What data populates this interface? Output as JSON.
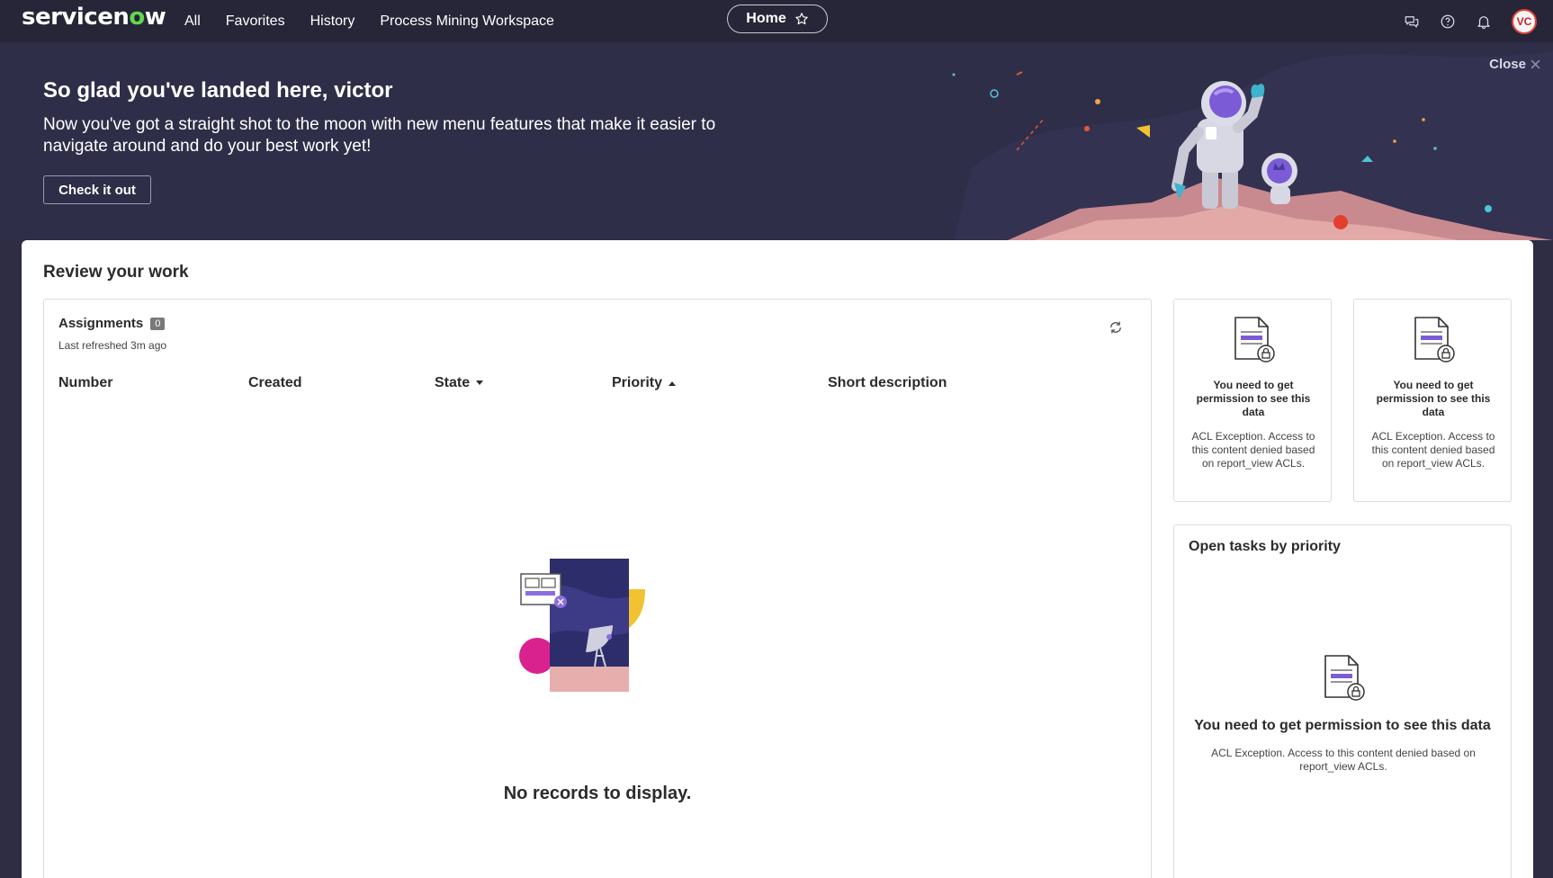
{
  "nav": {
    "logo_a": "servicen",
    "logo_o": "o",
    "logo_b": "w",
    "links": [
      "All",
      "Favorites",
      "History",
      "Process Mining Workspace"
    ],
    "home_label": "Home",
    "avatar_initials": "VC",
    "icons": [
      "chat-icon",
      "help-icon",
      "bell-icon"
    ]
  },
  "banner": {
    "title": "So glad you've landed here, victor",
    "subtitle": "Now you've got a straight shot to the moon with new menu features that make it easier to navigate around and do your best work yet!",
    "button": "Check it out",
    "close": "Close"
  },
  "review": {
    "title": "Review your work",
    "assignments": {
      "title": "Assignments",
      "count": "0",
      "refreshed": "Last refreshed 3m ago",
      "columns": [
        "Number",
        "Created",
        "State",
        "Priority",
        "Short description"
      ],
      "empty": "No records to display."
    },
    "perm_cards": [
      {
        "title": "You need to get permission to see this data",
        "desc": "ACL Exception. Access to this content denied based on report_view ACLs."
      },
      {
        "title": "You need to get permission to see this data",
        "desc": "ACL Exception. Access to this content denied based on report_view ACLs."
      }
    ],
    "tasks": {
      "title": "Open tasks by priority",
      "perm_title": "You need to get permission to see this data",
      "perm_desc": "ACL Exception. Access to this content denied based on report_view ACLs."
    }
  },
  "colors": {
    "nav_bg": "#262638",
    "banner_bg": "#2f2e48",
    "accent_green": "#62d84e",
    "accent_purple": "#7b5cd6"
  }
}
